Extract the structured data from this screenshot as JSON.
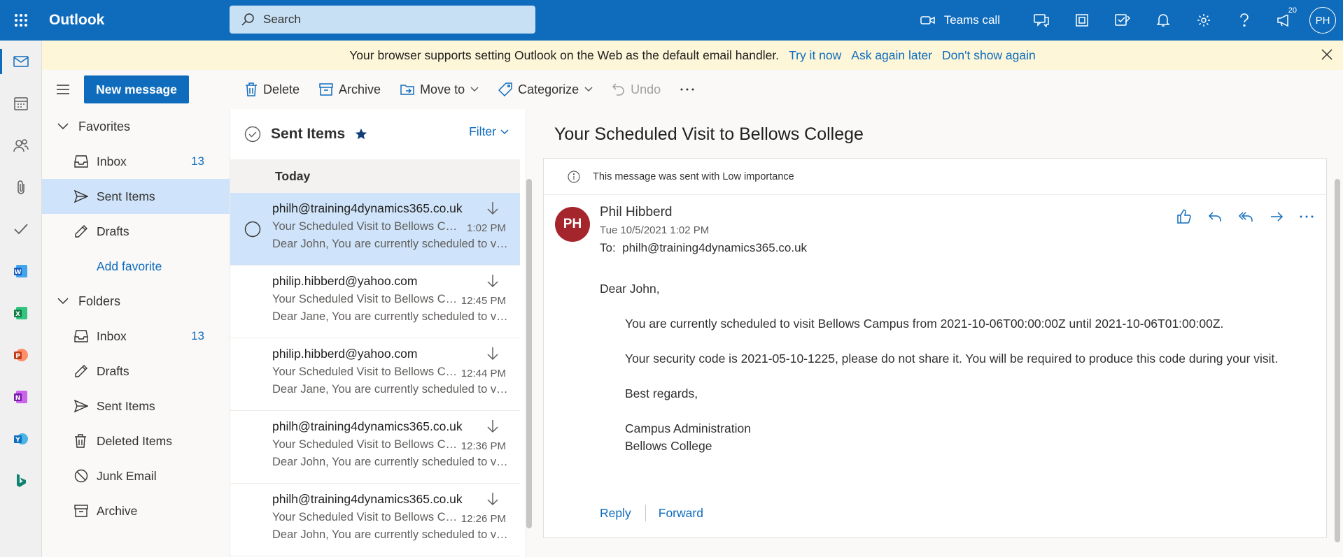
{
  "app": {
    "title": "Outlook"
  },
  "search": {
    "placeholder": "Search"
  },
  "topbar": {
    "teams_label": "Teams call",
    "notification_count": "20",
    "user_initials": "PH"
  },
  "banner": {
    "text": "Your browser supports setting Outlook on the Web as the default email handler.",
    "links": [
      "Try it now",
      "Ask again later",
      "Don't show again"
    ]
  },
  "toolbar": {
    "new_message": "New message",
    "delete": "Delete",
    "archive": "Archive",
    "move_to": "Move to",
    "categorize": "Categorize",
    "undo": "Undo"
  },
  "folders": {
    "favorites_label": "Favorites",
    "favorites": [
      {
        "label": "Inbox",
        "count": "13"
      },
      {
        "label": "Sent Items",
        "count": ""
      },
      {
        "label": "Drafts",
        "count": ""
      }
    ],
    "add_favorite": "Add favorite",
    "folders_label": "Folders",
    "items": [
      {
        "label": "Inbox",
        "count": "13"
      },
      {
        "label": "Drafts",
        "count": ""
      },
      {
        "label": "Sent Items",
        "count": ""
      },
      {
        "label": "Deleted Items",
        "count": ""
      },
      {
        "label": "Junk Email",
        "count": ""
      },
      {
        "label": "Archive",
        "count": ""
      }
    ]
  },
  "list": {
    "title": "Sent Items",
    "filter": "Filter",
    "section": "Today",
    "messages": [
      {
        "from": "philh@training4dynamics365.co.uk",
        "subject": "Your Scheduled Visit to Bellows College",
        "time": "1:02 PM",
        "preview": "Dear John, You are currently scheduled to visit Bellows Campus"
      },
      {
        "from": "philip.hibberd@yahoo.com",
        "subject": "Your Scheduled Visit to Bellows College",
        "time": "12:45 PM",
        "preview": "Dear Jane, You are currently scheduled to visit Bellows Campus"
      },
      {
        "from": "philip.hibberd@yahoo.com",
        "subject": "Your Scheduled Visit to Bellows College",
        "time": "12:44 PM",
        "preview": "Dear Jane, You are currently scheduled to visit Bellows Campus"
      },
      {
        "from": "philh@training4dynamics365.co.uk",
        "subject": "Your Scheduled Visit to Bellows College",
        "time": "12:36 PM",
        "preview": "Dear John, You are currently scheduled to visit Bellows Campus"
      },
      {
        "from": "philh@training4dynamics365.co.uk",
        "subject": "Your Scheduled Visit to Bellows College",
        "time": "12:26 PM",
        "preview": "Dear John, You are currently scheduled to visit Bellows Campus"
      }
    ]
  },
  "reading": {
    "title": "Your Scheduled Visit to Bellows College",
    "importance": "This message was sent with Low importance",
    "sender_initials": "PH",
    "sender_name": "Phil Hibberd",
    "date": "Tue 10/5/2021 1:02 PM",
    "to_label": "To:",
    "to": "philh@training4dynamics365.co.uk",
    "body": {
      "greeting": "Dear John,",
      "p1": "You are currently scheduled to visit Bellows Campus from 2021-10-06T00:00:00Z until 2021-10-06T01:00:00Z.",
      "p2": "Your security code is 2021-05-10-1225, please do not share it. You will be required to produce this code during your visit.",
      "closing": "Best regards,",
      "sig1": "Campus Administration",
      "sig2": "Bellows College"
    },
    "reply": "Reply",
    "forward": "Forward"
  },
  "colors": {
    "accent": "#0f6cbd",
    "selected": "#cfe4fa",
    "banner": "#fdf6d8",
    "avatar": "#a4262c"
  }
}
